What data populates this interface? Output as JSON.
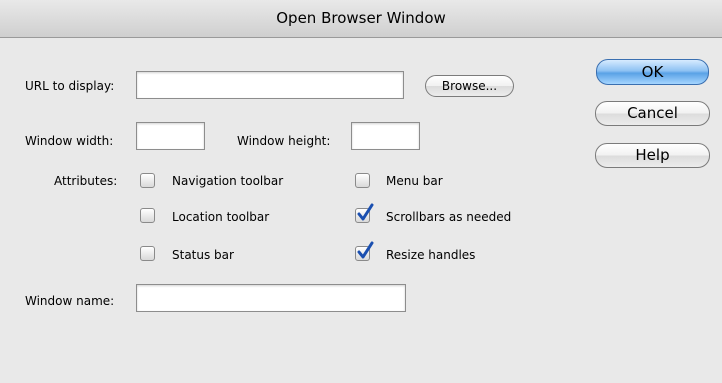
{
  "dialog": {
    "title": "Open Browser Window"
  },
  "url": {
    "label": "URL to display:",
    "value": "",
    "browse_label": "Browse..."
  },
  "size": {
    "width_label": "Window width:",
    "width_value": "",
    "height_label": "Window height:",
    "height_value": ""
  },
  "attributes": {
    "label": "Attributes:",
    "items": [
      {
        "label": "Navigation toolbar",
        "checked": false
      },
      {
        "label": "Menu bar",
        "checked": false
      },
      {
        "label": "Location toolbar",
        "checked": false
      },
      {
        "label": "Scrollbars as needed",
        "checked": true
      },
      {
        "label": "Status bar",
        "checked": false
      },
      {
        "label": "Resize handles",
        "checked": true
      }
    ]
  },
  "name": {
    "label": "Window name:",
    "value": ""
  },
  "buttons": {
    "ok": "OK",
    "cancel": "Cancel",
    "help": "Help"
  },
  "colors": {
    "checkmark": "#1a4fb0",
    "ok_button": "#5aa2e6"
  }
}
